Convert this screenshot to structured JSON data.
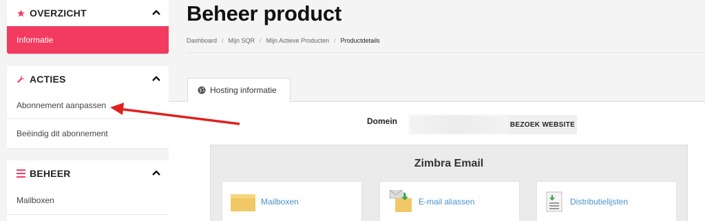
{
  "sidebar": {
    "overzicht": {
      "title": "OVERZICHT",
      "items": [
        {
          "label": "Informatie"
        }
      ]
    },
    "acties": {
      "title": "ACTIES",
      "items": [
        {
          "label": "Abonnement aanpassen"
        },
        {
          "label": "Beëindig dit abonnement"
        }
      ]
    },
    "beheer": {
      "title": "BEHEER",
      "items": [
        {
          "label": "Mailboxen"
        }
      ]
    }
  },
  "main": {
    "title": "Beheer product",
    "breadcrumb": [
      "Dashboard",
      "Mijn SQR",
      "Mijn Actieve Producten",
      "Productdetails"
    ],
    "tab": "Hosting informatie",
    "domain_label": "Domein",
    "visit_button": "BEZOEK WEBSITE",
    "zimbra": {
      "title": "Zimbra Email",
      "cards": [
        {
          "label": "Mailboxen",
          "icon": "folder-icon"
        },
        {
          "label": "E-mail aliassen",
          "icon": "mail-alias-icon"
        },
        {
          "label": "Distributielijsten",
          "icon": "document-list-icon"
        }
      ]
    }
  },
  "colors": {
    "accent": "#f23b5f",
    "link": "#4a8fd0",
    "arrow": "#e02020"
  }
}
